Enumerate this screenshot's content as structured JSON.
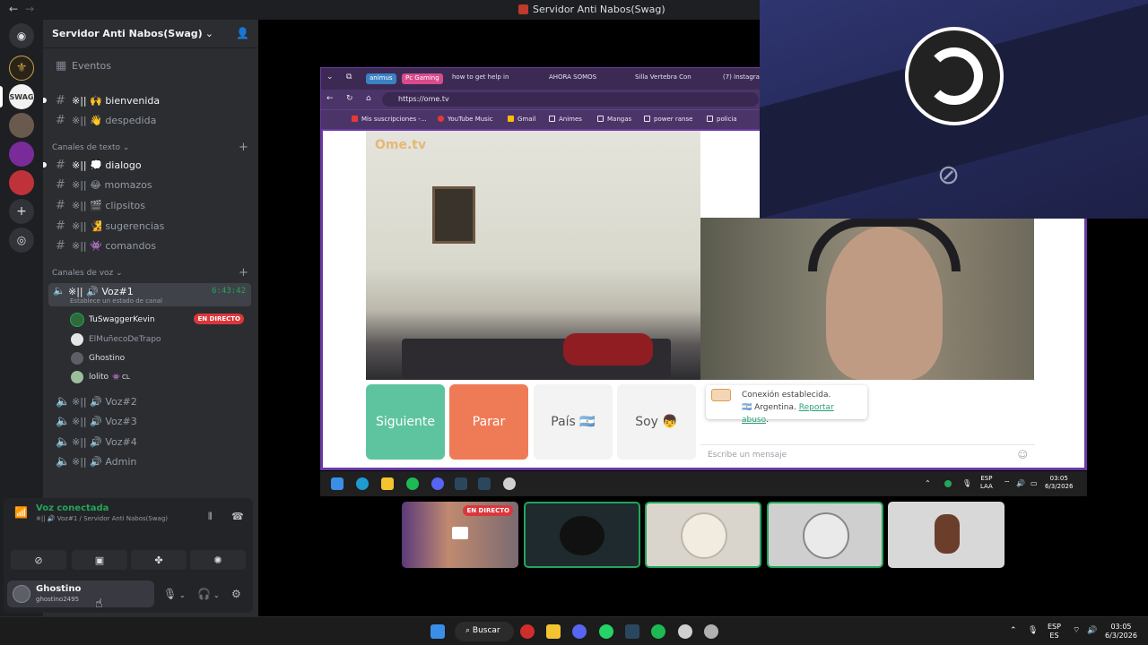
{
  "window": {
    "title": "Servidor Anti Nabos(Swag)",
    "back": "←",
    "forward": "→"
  },
  "server": {
    "name": "Servidor Anti Nabos(Swag)",
    "chevron": "⌄",
    "invite_icon": "person-add-icon"
  },
  "rail": {
    "items": [
      "discord-home-icon",
      "server-avatar-1",
      "server-swag-active",
      "server-avatar-3",
      "server-avatar-4",
      "server-avatar-5",
      "add-server-icon",
      "explore-icon"
    ]
  },
  "sidebar": {
    "events": "Eventos",
    "top_channels": [
      {
        "label": "※|| 🙌 bienvenida"
      },
      {
        "label": "※|| 👋 despedida"
      }
    ],
    "text_category": "Canales de texto",
    "text_channels": [
      {
        "label": "※|| 💭 dialogo"
      },
      {
        "label": "※|| 😂 momazos"
      },
      {
        "label": "※|| 🎬 clipsitos"
      },
      {
        "label": "※|| 🧏 sugerencias"
      },
      {
        "label": "※|| 👾 comandos"
      }
    ],
    "voice_category": "Canales de voz",
    "active_voice": {
      "label": "※|| 🔊 Voz#1",
      "timer": "6:43:42",
      "status": "Establece un estado de canal"
    },
    "voice_users": [
      {
        "name": "TuSwaggerKevin",
        "badge": "EN DIRECTO",
        "color": "#23a55a"
      },
      {
        "name": "ElMuñecoDeTrapo",
        "badge": "",
        "color": "#80848e"
      },
      {
        "name": "Ghostino",
        "badge": "",
        "color": "#23a55a"
      },
      {
        "name": "lolito",
        "badge": "👾 CL",
        "color": "#23a55a"
      }
    ],
    "voice_channels": [
      {
        "label": "※|| 🔊 Voz#2"
      },
      {
        "label": "※|| 🔊 Voz#3"
      },
      {
        "label": "※|| 🔊 Voz#4"
      },
      {
        "label": "※|| 🔊 Admin"
      }
    ]
  },
  "panel": {
    "voice_connected": "Voz conectada",
    "voice_sub": "※|| 🔊 Voz#1 / Servidor Anti Nabos(Swag)",
    "username": "Ghostino",
    "handle": "ghostino2495"
  },
  "browser": {
    "tags": [
      "animus",
      "Pc Gaming"
    ],
    "tabs": [
      "how to get help in",
      "AHORA SOMOS",
      "Silla Vertebra Con",
      "(7) Instagram"
    ],
    "url": "https://ome.tv",
    "bookmarks": [
      "Mis suscripciones -...",
      "YouTube Music",
      "Gmail",
      "Animes",
      "Mangas",
      "power ranse",
      "policia"
    ]
  },
  "ometv": {
    "logo": "Ome.tv",
    "buttons": [
      {
        "label": "Siguiente",
        "bg": "#5ec4a0",
        "color": "#ffffff"
      },
      {
        "label": "Parar",
        "bg": "#ef7b56",
        "color": "#ffffff"
      },
      {
        "label": "País 🇦🇷",
        "bg": "#f3f3f3",
        "color": "#555555"
      },
      {
        "label": "Soy 👦",
        "bg": "#f3f3f3",
        "color": "#555555"
      }
    ],
    "msg_line1": "Conexión establecida.",
    "msg_country": "🇦🇷 Argentina.",
    "msg_link": "Reportar abuso",
    "msg_end": ".",
    "placeholder": "Escribe un mensaje"
  },
  "inner_taskbar": {
    "lang1": "ESP",
    "lang2": "LAA",
    "time": "03:05",
    "date": "6/3/2026"
  },
  "tiles": [
    {
      "name": "stream-tile",
      "badge": "EN DIRECTO"
    },
    {
      "name": "pingu-tile",
      "badge": ""
    },
    {
      "name": "sketch-tile",
      "badge": ""
    },
    {
      "name": "anime-tile",
      "badge": ""
    },
    {
      "name": "sackboy-tile",
      "badge": ""
    }
  ],
  "taskbar": {
    "search": "Buscar",
    "lang1": "ESP",
    "lang2": "ES",
    "time": "03:05",
    "date": "6/3/2026"
  },
  "colors": {
    "green": "#23a55a",
    "red": "#da373c",
    "bg": "#2b2d31"
  }
}
